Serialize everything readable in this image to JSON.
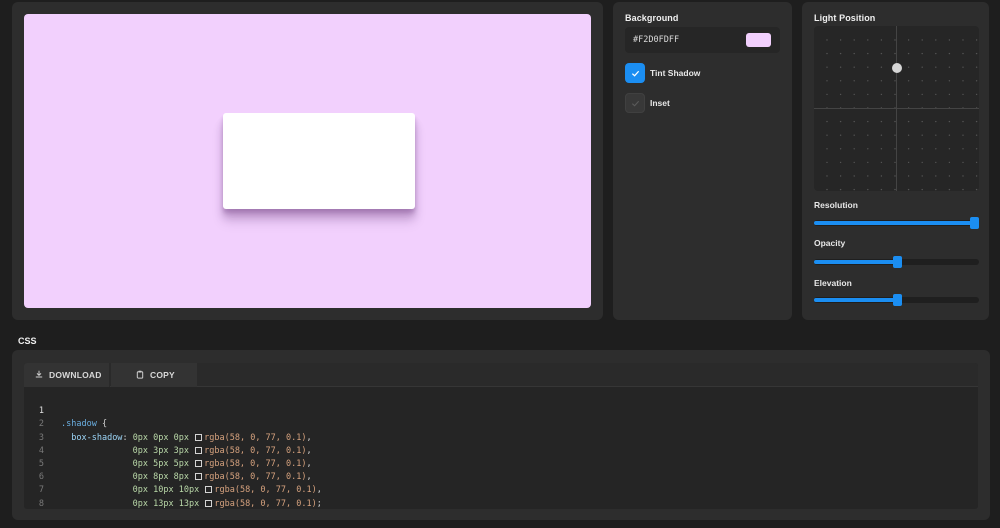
{
  "preview": {
    "background_color": "#F2D0FD",
    "card_color": "#FFFFFF"
  },
  "background": {
    "title": "Background",
    "hex_value": "#F2D0FDFF",
    "swatch_color": "#F2D0FD",
    "tint_shadow": {
      "label": "Tint Shadow",
      "checked": true
    },
    "inset": {
      "label": "Inset",
      "checked": false
    }
  },
  "light": {
    "title": "Light Position",
    "sliders": [
      {
        "label": "Resolution",
        "value_fraction": 1.0
      },
      {
        "label": "Opacity",
        "value_fraction": 0.5
      },
      {
        "label": "Elevation",
        "value_fraction": 0.5
      }
    ]
  },
  "css_section": {
    "heading": "CSS",
    "download_label": "DOWNLOAD",
    "copy_label": "COPY",
    "download_icon": "download-icon",
    "copy_icon": "copy-icon",
    "lines": [
      {
        "num": "1",
        "selector": ".shadow",
        "punct": " {"
      },
      {
        "num": "2",
        "prop": "box-shadow",
        "values": [
          "0px",
          "0px",
          "0px"
        ],
        "color": "rgba(58, 0, 77, 0.1)",
        "end": ","
      },
      {
        "num": "3",
        "values": [
          "0px",
          "3px",
          "3px"
        ],
        "color": "rgba(58, 0, 77, 0.1)",
        "end": ","
      },
      {
        "num": "4",
        "values": [
          "0px",
          "5px",
          "5px"
        ],
        "color": "rgba(58, 0, 77, 0.1)",
        "end": ","
      },
      {
        "num": "5",
        "values": [
          "0px",
          "8px",
          "8px"
        ],
        "color": "rgba(58, 0, 77, 0.1)",
        "end": ","
      },
      {
        "num": "6",
        "values": [
          "0px",
          "10px",
          "10px"
        ],
        "color": "rgba(58, 0, 77, 0.1)",
        "end": ","
      },
      {
        "num": "7",
        "values": [
          "0px",
          "13px",
          "13px"
        ],
        "color": "rgba(58, 0, 77, 0.1)",
        "end": ";"
      },
      {
        "num": "8",
        "closing": "}"
      }
    ]
  },
  "colors": {
    "accent": "#1B8EF2",
    "panel": "#2D2D2D",
    "app_background": "#1E1E1E"
  }
}
